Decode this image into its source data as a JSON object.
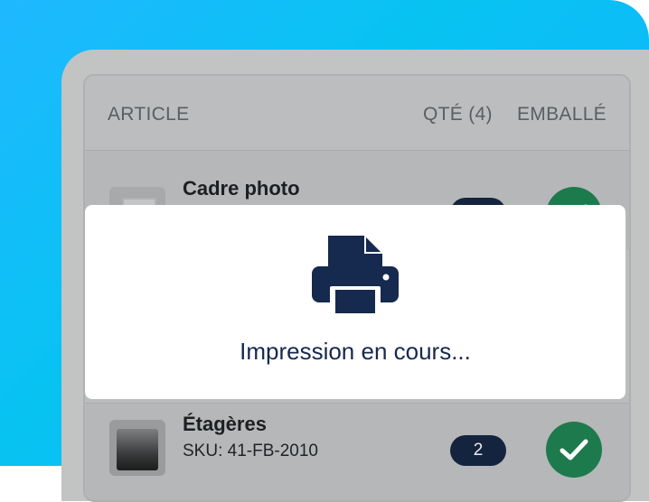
{
  "table": {
    "headers": {
      "article": "ARTICLE",
      "quantity": "QTÉ (4)",
      "packed": "EMBALLÉ"
    },
    "rows": [
      {
        "name": "Cadre photo",
        "sku": "",
        "qty": "",
        "packed": true
      },
      {
        "name": "Étagères",
        "sku": "SKU: 41-FB-2010",
        "qty": "2",
        "packed": true
      }
    ]
  },
  "overlay": {
    "message": "Impression en cours...",
    "icon": "printer-icon"
  },
  "colors": {
    "background_gradient_start": "#1fb8ff",
    "background_gradient_end": "#18b1ff",
    "overlay_text": "#16294e",
    "badge": "#15243e",
    "check": "#1d7a4d"
  }
}
